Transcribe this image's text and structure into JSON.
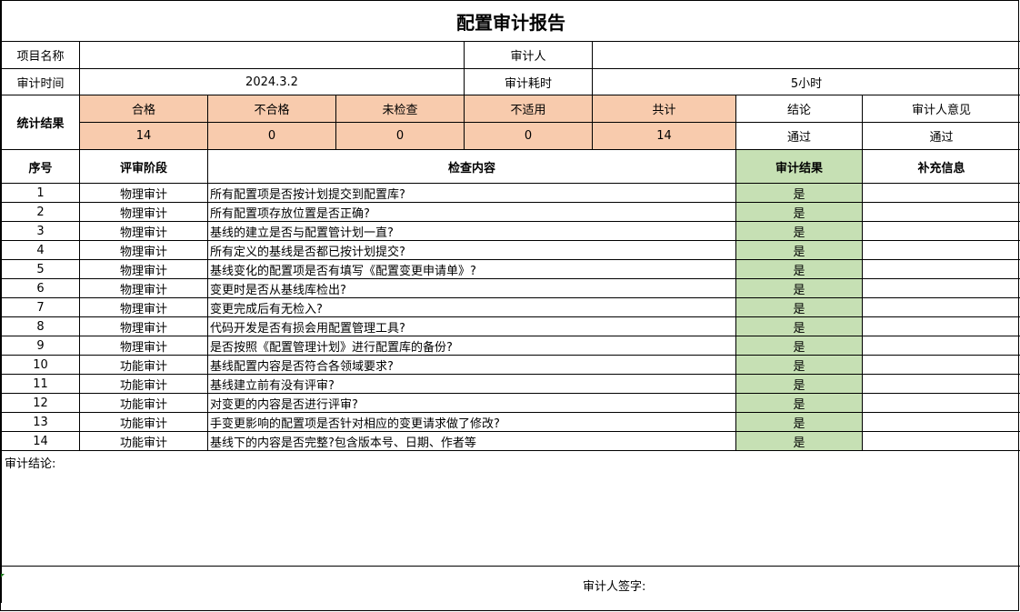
{
  "title": "配置审计报告",
  "info": {
    "project_name_label": "项目名称",
    "project_name_value": "",
    "auditor_label": "审计人",
    "auditor_value": "",
    "audit_time_label": "审计时间",
    "audit_time_value": "2024.3.2",
    "duration_label": "审计耗时",
    "duration_value": "5小时"
  },
  "stats": {
    "label": "统计结果",
    "headers": [
      "合格",
      "不合格",
      "未检查",
      "不适用",
      "共计"
    ],
    "values": [
      "14",
      "0",
      "0",
      "0",
      "14"
    ],
    "conclusion_label": "结论",
    "conclusion_value": "通过",
    "opinion_label": "审计人意见",
    "opinion_value": "通过"
  },
  "table": {
    "headers": {
      "no": "序号",
      "stage": "评审阶段",
      "content": "检查内容",
      "result": "审计结果",
      "extra": "补充信息"
    },
    "rows": [
      {
        "no": "1",
        "stage": "物理审计",
        "content": "所有配置项是否按计划提交到配置库?",
        "result": "是",
        "extra": ""
      },
      {
        "no": "2",
        "stage": "物理审计",
        "content": "所有配置项存放位置是否正确?",
        "result": "是",
        "extra": ""
      },
      {
        "no": "3",
        "stage": "物理审计",
        "content": "基线的建立是否与配置管计划一直?",
        "result": "是",
        "extra": ""
      },
      {
        "no": "4",
        "stage": "物理审计",
        "content": "所有定义的基线是否都已按计划提交?",
        "result": "是",
        "extra": ""
      },
      {
        "no": "5",
        "stage": "物理审计",
        "content": "基线变化的配置项是否有填写《配置变更申请单》?",
        "result": "是",
        "extra": ""
      },
      {
        "no": "6",
        "stage": "物理审计",
        "content": "变更时是否从基线库检出?",
        "result": "是",
        "extra": ""
      },
      {
        "no": "7",
        "stage": "物理审计",
        "content": "变更完成后有无检入?",
        "result": "是",
        "extra": ""
      },
      {
        "no": "8",
        "stage": "物理审计",
        "content": "代码开发是否有损会用配置管理工具?",
        "result": "是",
        "extra": ""
      },
      {
        "no": "9",
        "stage": "物理审计",
        "content": "是否按照《配置管理计划》进行配置库的备份?",
        "result": "是",
        "extra": ""
      },
      {
        "no": "10",
        "stage": "功能审计",
        "content": "基线配置内容是否符合各领域要求?",
        "result": "是",
        "extra": ""
      },
      {
        "no": "11",
        "stage": "功能审计",
        "content": "基线建立前有没有评审?",
        "result": "是",
        "extra": ""
      },
      {
        "no": "12",
        "stage": "功能审计",
        "content": "对变更的内容是否进行评审?",
        "result": "是",
        "extra": ""
      },
      {
        "no": "13",
        "stage": "功能审计",
        "content": "手变更影响的配置项是否针对相应的变更请求做了修改?",
        "result": "是",
        "extra": ""
      },
      {
        "no": "14",
        "stage": "功能审计",
        "content": "基线下的内容是否完整?包含版本号、日期、作者等",
        "result": "是",
        "extra": ""
      }
    ]
  },
  "footer": {
    "conclusion_label": "审计结论:",
    "signature_label": "审计人签字:"
  },
  "colors": {
    "stats_header_bg": "#f8cbad",
    "result_column_bg": "#c6e0b4"
  }
}
